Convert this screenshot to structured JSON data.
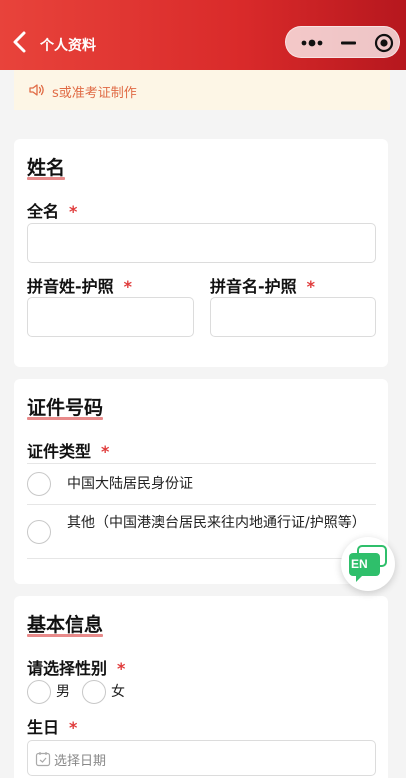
{
  "header": {
    "title": "个人资料"
  },
  "notice": {
    "text": "s或准考证制作"
  },
  "name_section": {
    "title": "姓名",
    "full_name_label": "全名",
    "surname_label": "拼音姓-护照",
    "given_name_label": "拼音名-护照",
    "required_mark": "*"
  },
  "id_section": {
    "title": "证件号码",
    "type_label": "证件类型",
    "required_mark": "*",
    "options": [
      "中国大陆居民身份证",
      "其他（中国港澳台居民来往内地通行证/护照等）"
    ]
  },
  "basic_section": {
    "title": "基本信息",
    "gender_label": "请选择性别",
    "gender_options": [
      "男",
      "女"
    ],
    "birthday_label": "生日",
    "birthday_placeholder": "选择日期",
    "required_mark": "*"
  },
  "floating": {
    "en_label": "EN"
  },
  "colors": {
    "accent": "#d92a2a",
    "required": "#e03b3b",
    "underline": "#e88a8a",
    "notice_bg": "#fdf6e6",
    "en_green": "#2fbf6b"
  }
}
